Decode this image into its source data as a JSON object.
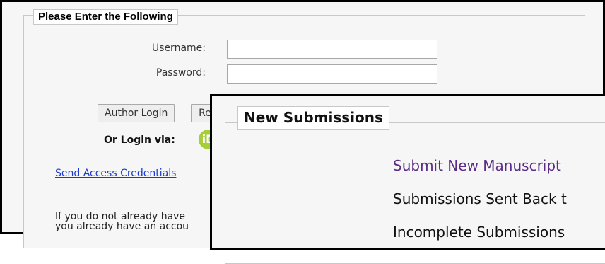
{
  "login": {
    "legend": "Please Enter the Following",
    "username_label": "Username:",
    "password_label": "Password:",
    "username_value": "",
    "password_value": "",
    "author_login_label": "Author Login",
    "second_button_label": "Re",
    "or_login_via": "Or Login via:",
    "orcid_icon": "orcid-icon",
    "send_credentials_link": "Send Access Credentials",
    "info_line1": "If you do not already have",
    "info_line2": "you already have an accou"
  },
  "new_submissions": {
    "legend": "New Submissions",
    "items": [
      {
        "label": "Submit New Manuscript",
        "color": "#5b2d87"
      },
      {
        "label": "Submissions Sent Back t",
        "color": "#111111"
      },
      {
        "label": "Incomplete Submissions",
        "color": "#111111"
      }
    ]
  },
  "colors": {
    "link": "#1a3bcc",
    "divider": "#c44a4a",
    "orcid": "#a6ce39"
  }
}
